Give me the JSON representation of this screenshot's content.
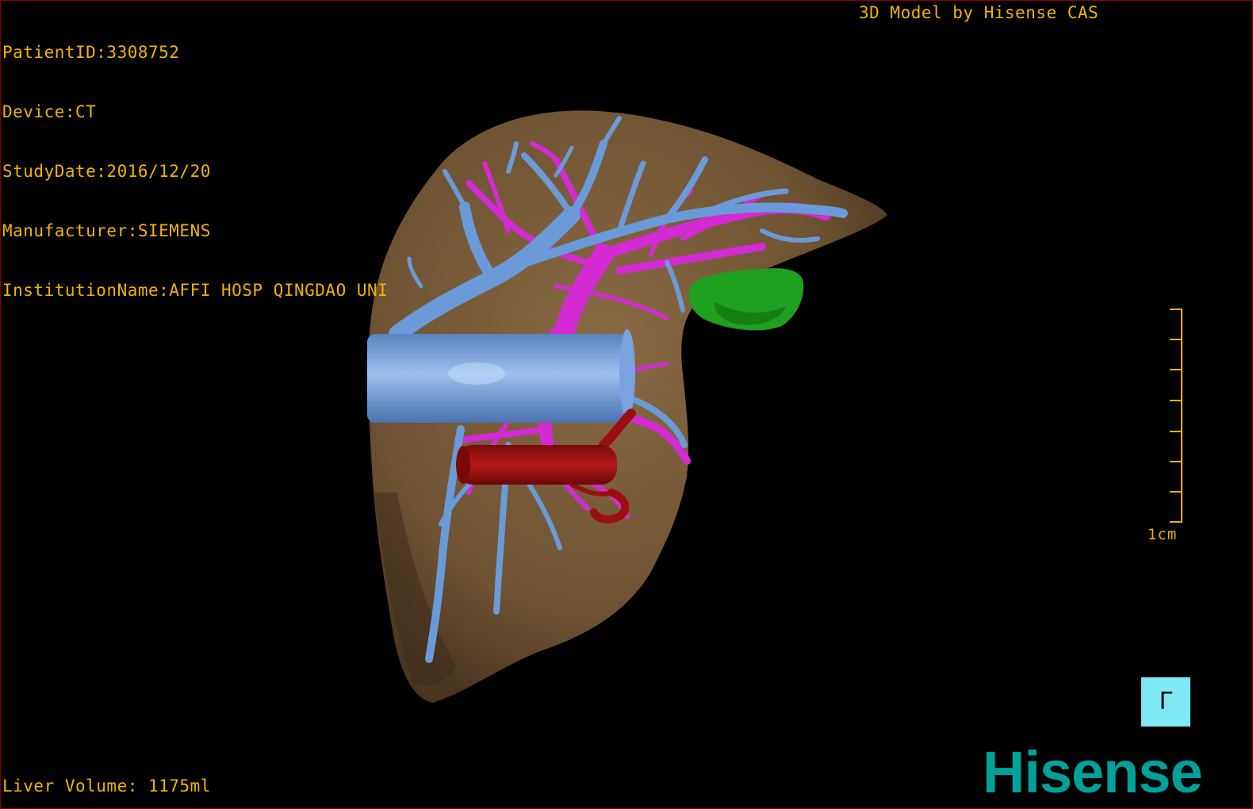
{
  "info": {
    "patient_id": "PatientID:3308752",
    "device": "Device:CT",
    "study_date": "StudyDate:2016/12/20",
    "manufacturer": "Manufacturer:SIEMENS",
    "institution": "InstitutionName:AFFI HOSP QINGDAO UNI"
  },
  "title": "3D Model by Hisense CAS",
  "liver_volume": "Liver Volume: 1175ml",
  "scale": {
    "label": "1cm",
    "tick_count": 8
  },
  "orientation": {
    "label": "ᒥ",
    "icon": "orientation-cube-icon"
  },
  "brand": "Hisense",
  "colors": {
    "overlay_text": "#f0b400",
    "liver": "#7a5a38",
    "hepatic_vein": "#6a9ad8",
    "portal_vein": "#d42ad4",
    "artery": "#9a1010",
    "tumor": "#1fa01f",
    "brand": "#00a19a",
    "cube": "#7fe8f5"
  }
}
